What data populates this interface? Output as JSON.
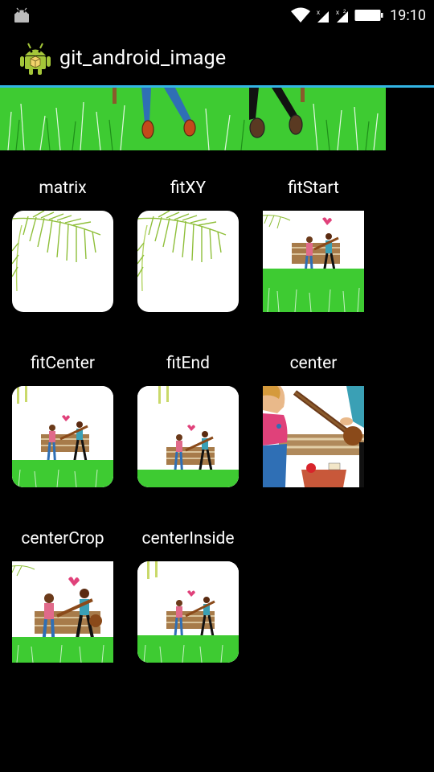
{
  "status_bar": {
    "time": "19:10",
    "icons": [
      "android-debug-icon",
      "wifi-icon",
      "cellular-signal-icon",
      "cellular-signal-2-icon",
      "battery-icon"
    ]
  },
  "app_bar": {
    "title": "git_android_image",
    "accent_color": "#33b5e5"
  },
  "scale_types": [
    {
      "label": "matrix"
    },
    {
      "label": "fitXY"
    },
    {
      "label": "fitStart"
    },
    {
      "label": "fitCenter"
    },
    {
      "label": "fitEnd"
    },
    {
      "label": "center"
    },
    {
      "label": "centerCrop"
    },
    {
      "label": "centerInside"
    }
  ]
}
